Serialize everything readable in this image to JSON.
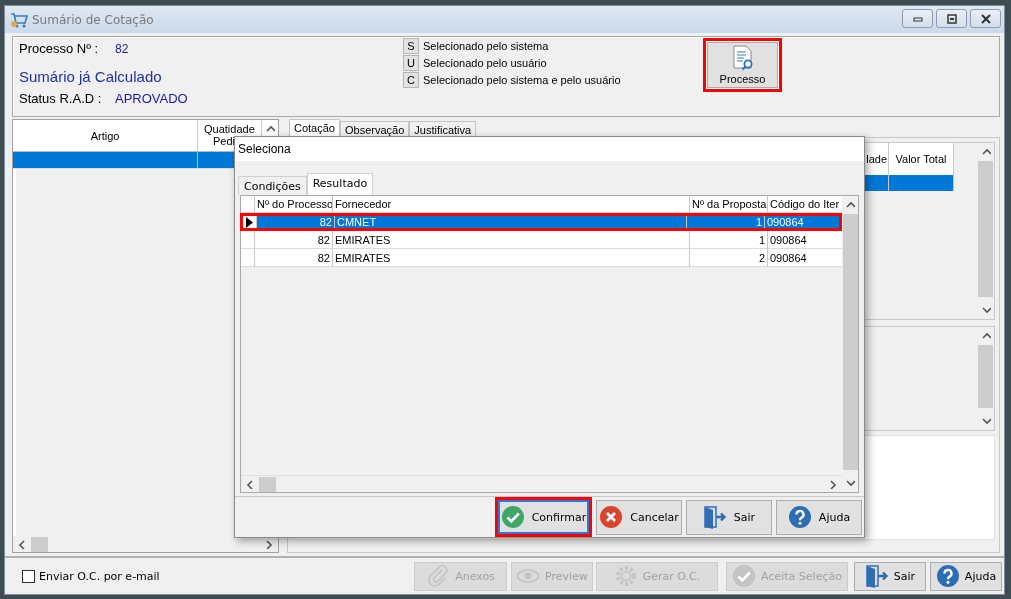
{
  "window": {
    "title": "Sumário de Cotação"
  },
  "header": {
    "process_label": "Processo Nº :",
    "process_value": "82",
    "summary_status": "Sumário já Calculado",
    "rad_label": "Status R.A.D :",
    "rad_value": "APROVADO",
    "legend": [
      {
        "key": "S",
        "text": "Selecionado pelo sistema"
      },
      {
        "key": "U",
        "text": "Selecionado pelo usuário"
      },
      {
        "key": "C",
        "text": "Selecionado pelo sistema e pelo usuário"
      }
    ],
    "process_button": {
      "label": "Processo",
      "highlighted": true
    }
  },
  "items_grid": {
    "columns": [
      {
        "lines": [
          "Artigo"
        ]
      },
      {
        "lines": [
          "Quatidade",
          "Pedi"
        ]
      }
    ],
    "rows": [
      {
        "selected": true
      }
    ]
  },
  "tabs": [
    {
      "label": "Cotação",
      "selected": true
    },
    {
      "label": "Observação",
      "selected": false
    },
    {
      "label": "Justificativa",
      "selected": false
    }
  ],
  "quote_grid": {
    "columns": [
      "lade",
      "Valor Total"
    ],
    "rows": [
      {
        "selected": true
      }
    ]
  },
  "dialog": {
    "title": "Seleciona",
    "tabs": [
      {
        "label": "Condições",
        "selected": false
      },
      {
        "label": "Resultado",
        "selected": true
      }
    ],
    "grid": {
      "columns": [
        {
          "label": "Nº do Processo",
          "kind": "number"
        },
        {
          "label": "Fornecedor",
          "kind": "text"
        },
        {
          "label": "Nº da Proposta",
          "kind": "number"
        },
        {
          "label": "Código do Iter",
          "kind": "text"
        }
      ],
      "rows": [
        {
          "cells": [
            "82",
            "CMNET",
            "1",
            "090864"
          ],
          "selected": true,
          "highlighted": true
        },
        {
          "cells": [
            "82",
            "EMIRATES",
            "1",
            "090864"
          ],
          "selected": false,
          "highlighted": false
        },
        {
          "cells": [
            "82",
            "EMIRATES",
            "2",
            "090864"
          ],
          "selected": false,
          "highlighted": false
        }
      ]
    },
    "buttons": [
      {
        "kind": "confirm",
        "label": "Confirmar",
        "highlighted": true
      },
      {
        "kind": "cancel",
        "label": "Cancelar",
        "highlighted": false
      },
      {
        "kind": "exit",
        "label": "Sair",
        "highlighted": false
      },
      {
        "kind": "help",
        "label": "Ajuda",
        "highlighted": false
      }
    ]
  },
  "footer": {
    "email_checkbox": {
      "label": "Enviar O.C. por e-mail",
      "checked": false
    },
    "buttons": [
      {
        "kind": "attach",
        "label": "Anexos",
        "disabled": true
      },
      {
        "kind": "preview",
        "label": "Preview",
        "disabled": true
      },
      {
        "kind": "generate",
        "label": "Gerar O.C.",
        "disabled": true
      },
      {
        "kind": "accept",
        "label": "Aceita Seleção",
        "disabled": true
      },
      {
        "kind": "exit",
        "label": "Sair",
        "disabled": false
      },
      {
        "kind": "help",
        "label": "Ajuda",
        "disabled": false
      }
    ]
  }
}
